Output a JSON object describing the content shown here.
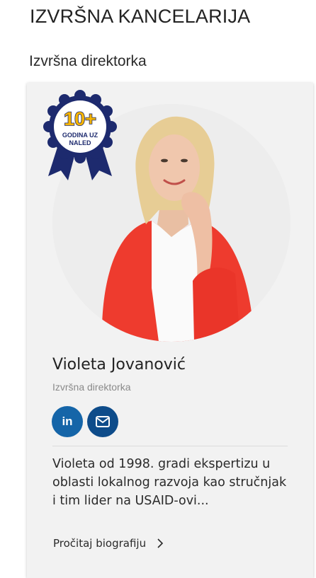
{
  "section": {
    "title": "IZVRŠNA KANCELARIJA"
  },
  "subsection": {
    "title": "Izvršna direktorka"
  },
  "badge": {
    "number": "10+",
    "line1": "GODINA UZ",
    "line2": "NALED"
  },
  "person": {
    "name": "Violeta Jovanović",
    "role": "Izvršna direktorka",
    "bio": "Violeta od 1998. gradi ekspertizu u oblasti lokalnog razvoja kao stručnjak i tim lider na USAID-ovi...",
    "read_more": "Pročitaj biografiju"
  },
  "social": {
    "linkedin_label": "in",
    "email_icon": "envelope-icon"
  },
  "colors": {
    "badge_navy": "#1d2a6e",
    "badge_gold": "#f5b400",
    "linkedin": "#1565a8",
    "email": "#0e4c8a",
    "jacket": "#ee3b2e"
  }
}
